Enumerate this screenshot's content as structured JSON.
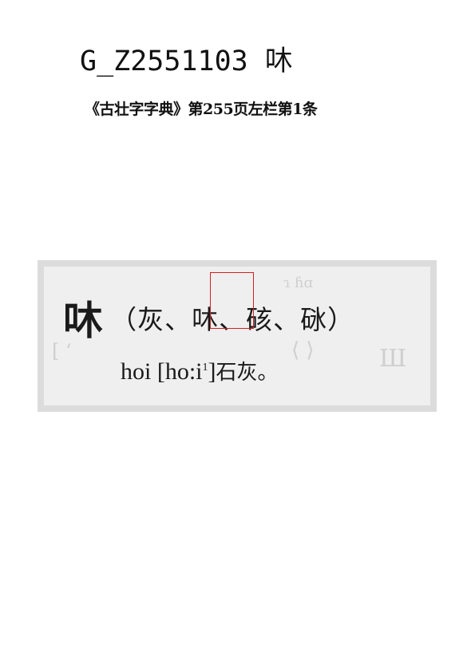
{
  "header": {
    "title": "G_Z2551103 㕲"
  },
  "source": {
    "citation": "《古壮字字典》第255页左栏第1条"
  },
  "entry": {
    "headword": "㕲",
    "variants": "（灰、㕲、硋、砯）",
    "romanization": "hoi",
    "ipa_open": "[ho:i",
    "tone": "1",
    "ipa_close": "]",
    "definition": "石灰。"
  },
  "colors": {
    "highlight_border": "#d32020",
    "scan_background": "#efefef",
    "scan_frame": "#dcdcdc"
  }
}
